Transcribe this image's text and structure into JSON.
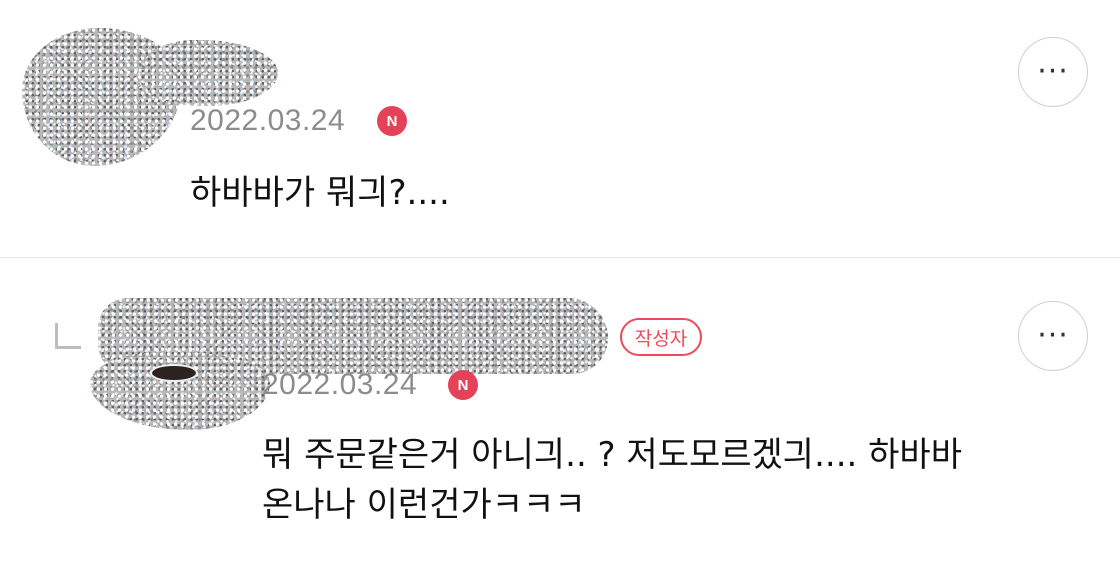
{
  "comments": [
    {
      "date": "2022.03.24",
      "new_badge": "N",
      "text": "하바바가 뭐긔?....",
      "more_icon": "more-dots-icon",
      "more_label": "···"
    },
    {
      "date": "2022.03.24",
      "new_badge": "N",
      "author_badge": "작성자",
      "text_line1": "뭐 주문같은거 아니긔.. ? 저도모르겠긔.... 하바바",
      "text_line2": "온나나 이런건가ㅋㅋㅋ",
      "more_icon": "more-dots-icon",
      "more_label": "···"
    }
  ],
  "colors": {
    "badge_red": "#e44258",
    "author_red": "#ef4a5c",
    "date_gray": "#8c8c8c",
    "divider": "#e6e6e6"
  }
}
